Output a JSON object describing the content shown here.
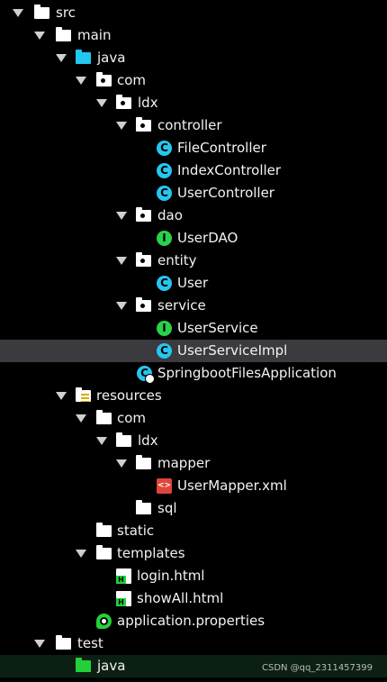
{
  "tree": {
    "src": "src",
    "main": "main",
    "java": "java",
    "com": "com",
    "ldx": "ldx",
    "controller": "controller",
    "file_controller": "FileController",
    "index_controller": "IndexController",
    "user_controller": "UserController",
    "dao": "dao",
    "user_dao": "UserDAO",
    "entity": "entity",
    "user": "User",
    "service": "service",
    "user_service": "UserService",
    "user_service_impl": "UserServiceImpl",
    "app": "SpringbootFilesApplication",
    "resources": "resources",
    "res_com": "com",
    "res_ldx": "ldx",
    "mapper": "mapper",
    "user_mapper": "UserMapper.xml",
    "sql": "sql",
    "static": "static",
    "templates": "templates",
    "login": "login.html",
    "show_all": "showAll.html",
    "app_props": "application.properties",
    "test": "test",
    "test_java": "java"
  },
  "icons": {
    "class_letter": "C",
    "interface_letter": "I",
    "html_letter": "H",
    "xml_symbol": "<>"
  },
  "colors": {
    "class": "#26c6ee",
    "interface": "#2ad24a",
    "selected_row": "#3a3a3f"
  },
  "watermark": "CSDN @qq_2311457399"
}
